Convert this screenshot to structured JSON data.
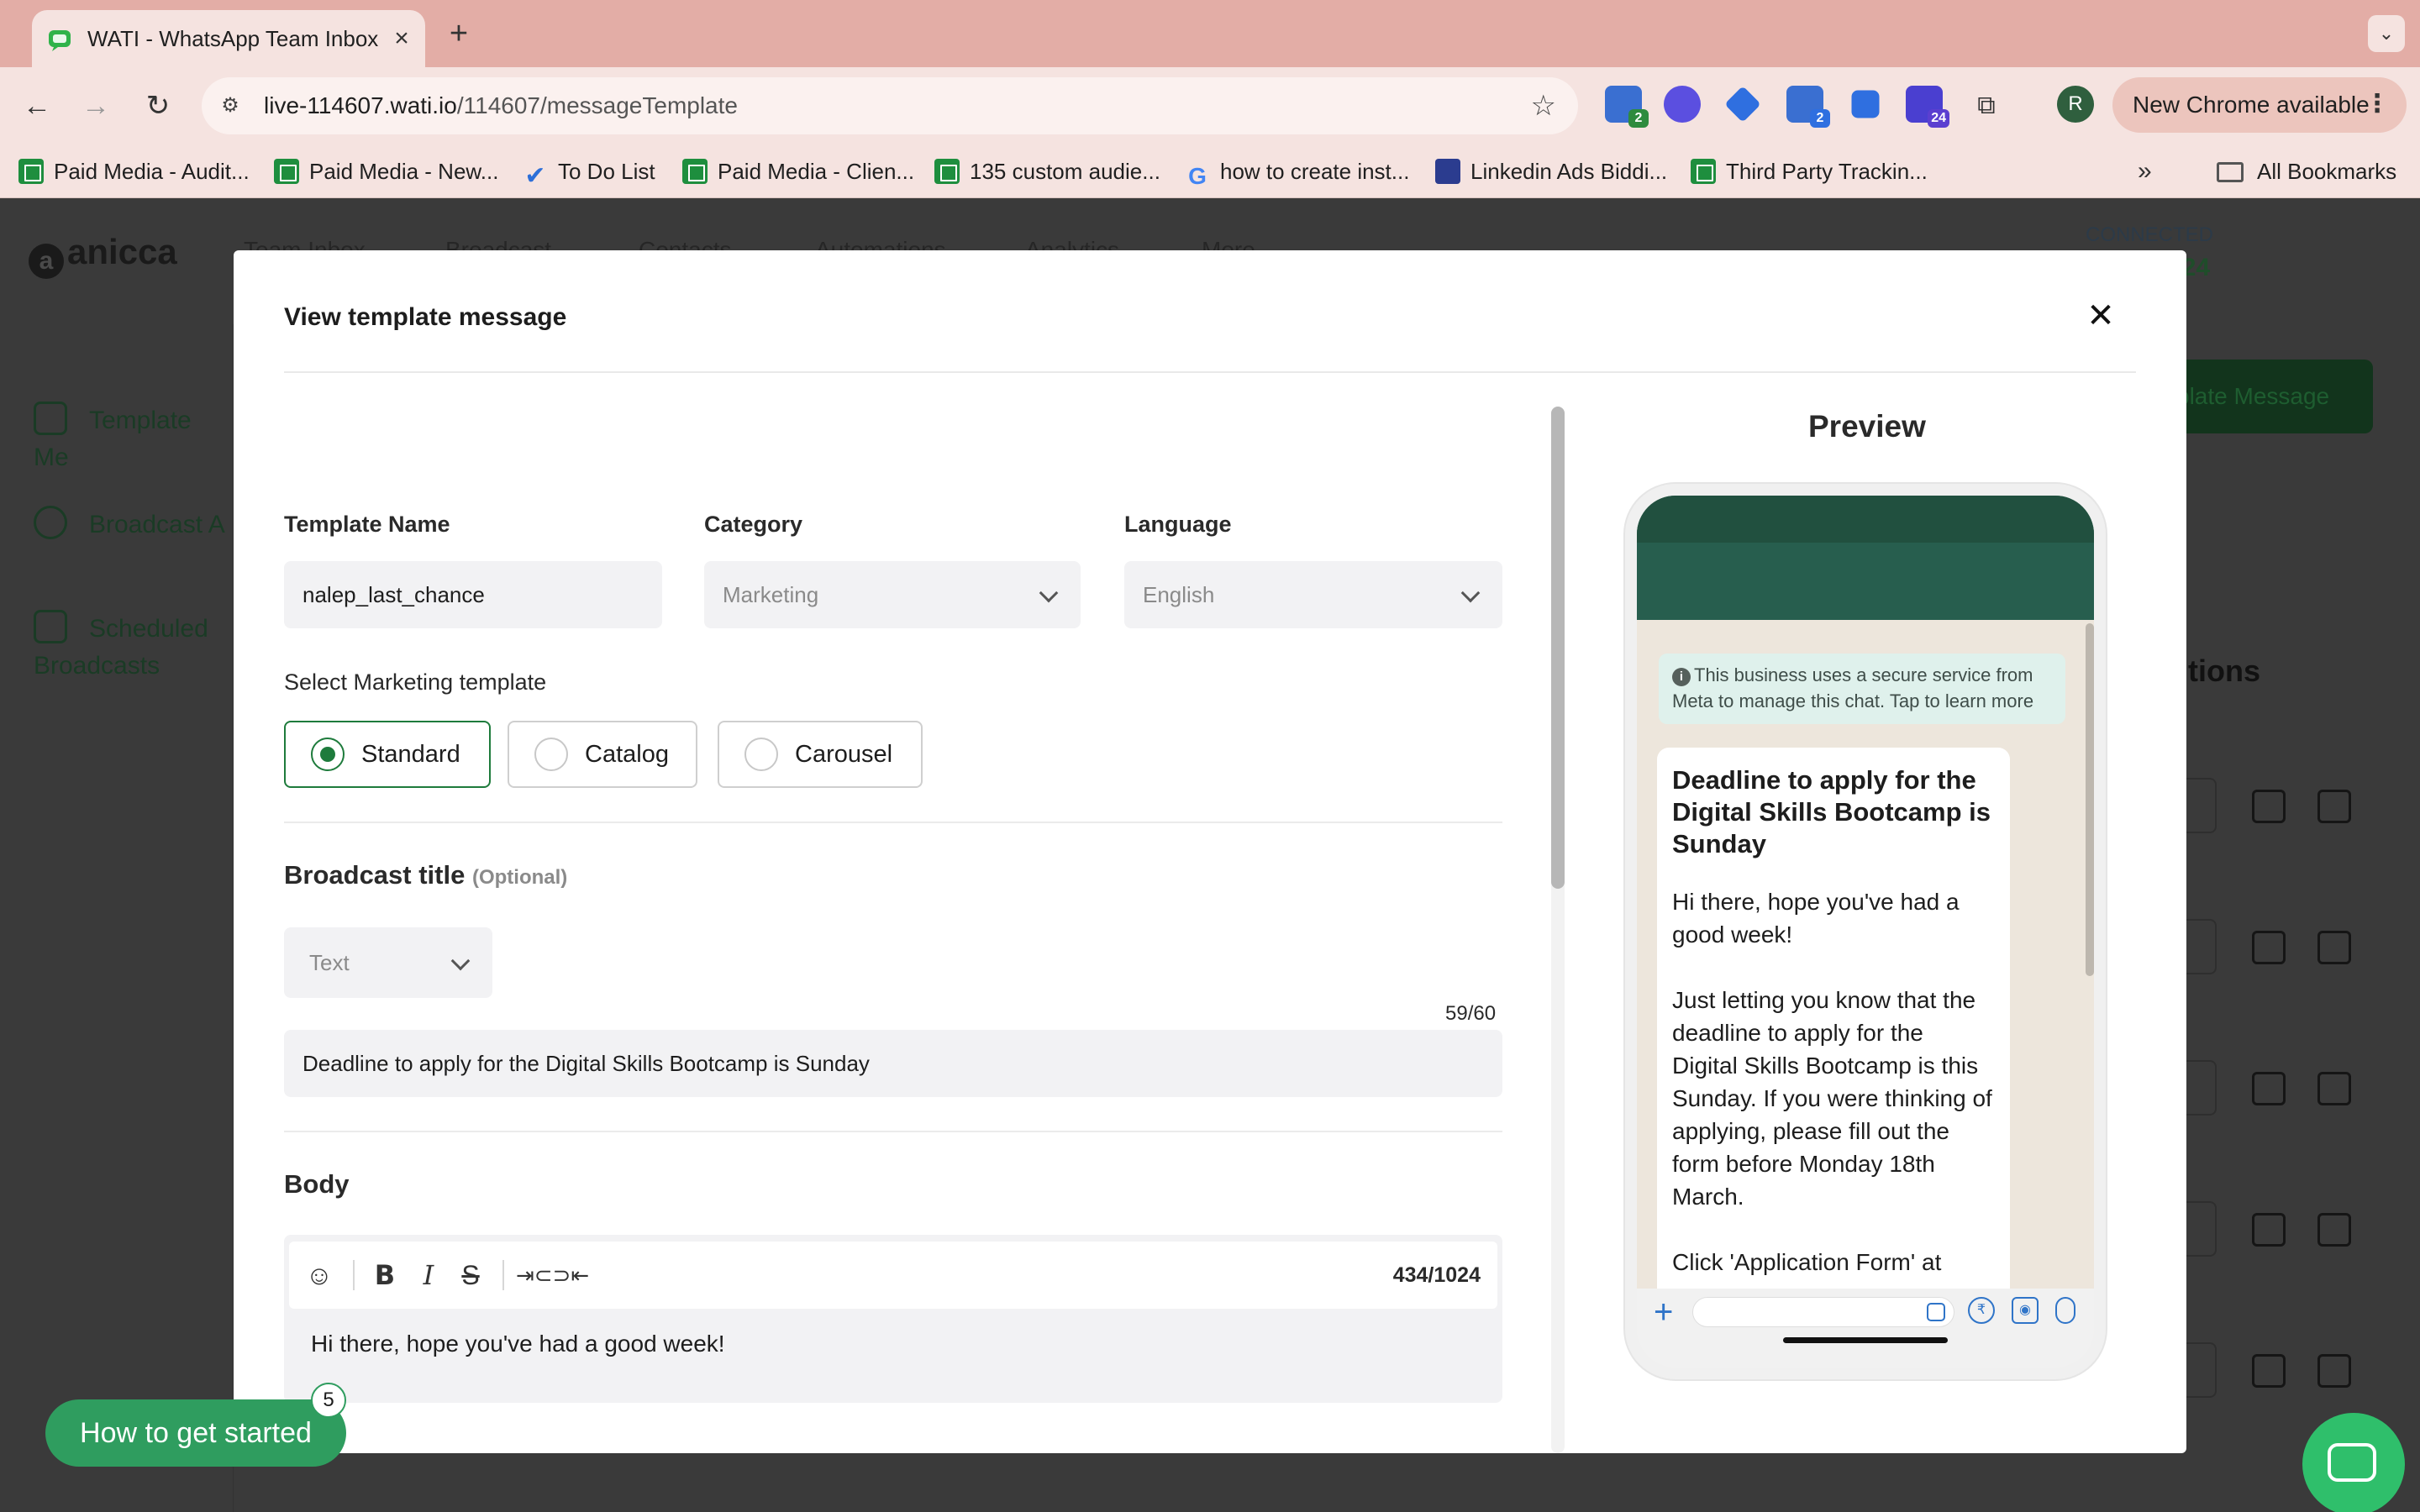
{
  "browser": {
    "tab_title": "WATI - WhatsApp Team Inbox",
    "url_host": "live-114607.wati.io",
    "url_path": "/114607/messageTemplate",
    "profile_initial": "R",
    "new_chrome_label": "New Chrome available",
    "extensions": [
      {
        "name": "extension-1",
        "badge": "2",
        "color": "#3a6fd1",
        "badge_color": "#2e8b3e"
      },
      {
        "name": "extension-2",
        "badge": "",
        "color": "#5b4fe0",
        "badge_color": ""
      },
      {
        "name": "extension-3",
        "badge": "",
        "color": "#2f6fe0",
        "badge_color": ""
      },
      {
        "name": "extension-4",
        "badge": "2",
        "color": "#3a6fd1",
        "badge_color": "#2f6fe0"
      },
      {
        "name": "extension-5",
        "badge": "",
        "color": "#2f6fe0",
        "badge_color": ""
      },
      {
        "name": "extension-6",
        "badge": "24",
        "color": "#4a3fd0",
        "badge_color": "#5b3fd0"
      }
    ],
    "bookmarks": [
      "Paid Media - Audit...",
      "Paid Media - New...",
      "To Do List",
      "Paid Media - Clien...",
      "135 custom audie...",
      "how to create inst...",
      "Linkedin Ads Biddi...",
      "Third Party Trackin..."
    ],
    "all_bookmarks": "All Bookmarks"
  },
  "background": {
    "logo": "anicca",
    "logo_initial": "a",
    "nav": [
      "Team Inbox",
      "Broadcast",
      "Contacts",
      "Automations",
      "Analytics",
      "More"
    ],
    "connected": "CONNECTED",
    "phone_fragment": "547224",
    "sidebar": [
      "Template Me",
      "Broadcast A",
      "Scheduled\nBroadcasts"
    ],
    "button_fragment": "plate Message",
    "heading_fragment": "tions"
  },
  "modal": {
    "title": "View template message",
    "template_name_label": "Template Name",
    "template_name_value": "nalep_last_chance",
    "category_label": "Category",
    "category_value": "Marketing",
    "language_label": "Language",
    "language_value": "English",
    "select_template_label": "Select Marketing template",
    "template_types": [
      "Standard",
      "Catalog",
      "Carousel"
    ],
    "selected_type": "Standard",
    "broadcast_title_label": "Broadcast title",
    "optional_label": "(Optional)",
    "header_type": "Text",
    "header_counter": "59/60",
    "header_text": "Deadline to apply for the Digital Skills Bootcamp is Sunday",
    "body_label": "Body",
    "body_counter": "434/1024",
    "body_text": "Hi there, hope you've had a good week!"
  },
  "preview": {
    "title": "Preview",
    "system_message": "This business uses a secure service from Meta to manage this chat. Tap to learn more",
    "bubble_title": "Deadline to apply for the Digital Skills Bootcamp is Sunday",
    "bubble_body": "Hi there, hope you've had a good week!\n\nJust letting you know that the deadline to apply for the Digital Skills Bootcamp is this Sunday. If you were thinking of applying, please fill out the form before Monday 18th March.\n\nClick 'Application Form' at"
  },
  "help": {
    "get_started": "How to get started",
    "badge": "5"
  },
  "colors": {
    "accent": "#1e7b3c",
    "whatsapp_header": "#275e4e",
    "chrome_tabbar": "#e3ada6"
  }
}
